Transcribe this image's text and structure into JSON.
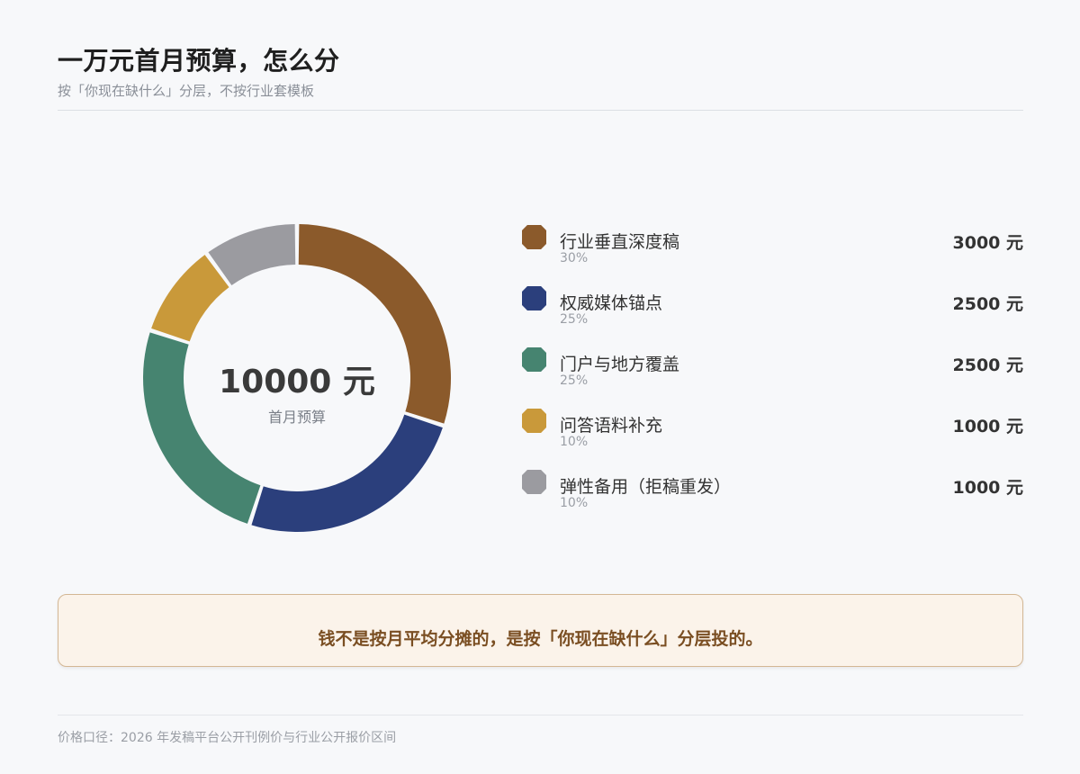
{
  "header": {
    "title": "一万元首月预算，怎么分",
    "subtitle": "按「你现在缺什么」分层，不按行业套模板"
  },
  "chart_data": {
    "type": "pie",
    "total_value": "10000 元",
    "total_label": "首月预算",
    "unit": "元",
    "slices": [
      {
        "name": "行业垂直深度稿",
        "value": 3000,
        "percent": "30%",
        "amount": "3000 元",
        "color": "#8b5a2b"
      },
      {
        "name": "权威媒体锚点",
        "value": 2500,
        "percent": "25%",
        "amount": "2500 元",
        "color": "#2b3f7c"
      },
      {
        "name": "门户与地方覆盖",
        "value": 2500,
        "percent": "25%",
        "amount": "2500 元",
        "color": "#468470"
      },
      {
        "name": "问答语料补充",
        "value": 1000,
        "percent": "10%",
        "amount": "1000 元",
        "color": "#c9993a"
      },
      {
        "name": "弹性备用（拒稿重发）",
        "value": 1000,
        "percent": "10%",
        "amount": "1000 元",
        "color": "#9b9ba0"
      }
    ]
  },
  "note": {
    "text": "钱不是按月平均分摊的，是按「你现在缺什么」分层投的。"
  },
  "footer": {
    "text": "价格口径：2026 年发稿平台公开刊例价与行业公开报价区间"
  }
}
